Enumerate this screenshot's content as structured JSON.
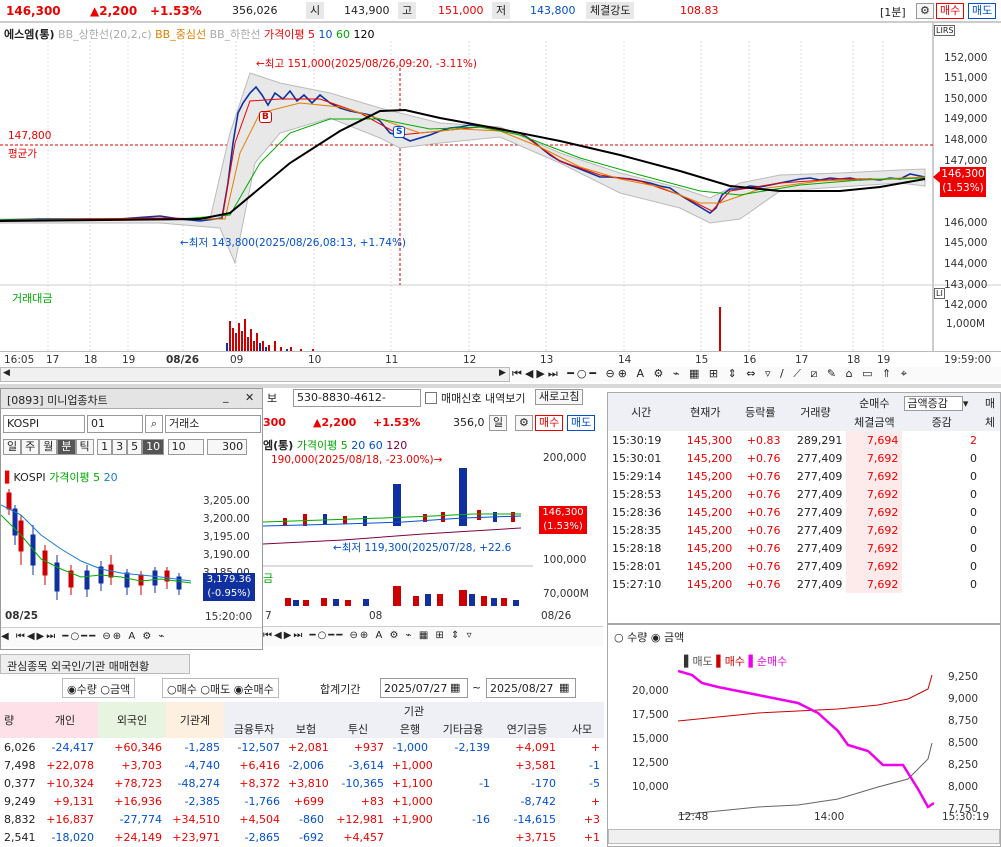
{
  "top": {
    "price": "146,300",
    "change": "▲2,200",
    "change_pct": "+1.53%",
    "volume": "356,026",
    "open_label": "시",
    "open": "143,900",
    "high_label": "고",
    "high": "151,000",
    "low_label": "저",
    "low": "143,800",
    "strength_label": "체결강도",
    "strength": "108.83",
    "interval": "[1분]",
    "buy": "매수",
    "sell": "매도"
  },
  "main": {
    "legend": {
      "name": "에스엠(통)",
      "bb_up": "BB_상한선(20,2,c)",
      "bb_mid": "BB_중심선",
      "bb_low": "BB_하한선",
      "ma": "가격이평 5",
      "ma10": "10",
      "ma60": "60",
      "ma120": "120"
    },
    "high_note": "←최고 151,000(2025/08/26,09:20, -3.11%)",
    "low_note": "←최저 143,800(2025/08/26,08:13, +1.74%)",
    "avg_value": "147,800",
    "avg_label": "평균가",
    "cur_price": "146,300",
    "cur_pct": "(1.53%)",
    "y_ticks": [
      "152,000",
      "151,000",
      "150,000",
      "149,000",
      "148,000",
      "147,000",
      "146,000",
      "145,000",
      "144,000",
      "143,000",
      "142,000"
    ],
    "vol_label": "거래대금",
    "vol_tick": "1,000M",
    "x_labels": [
      "16:05",
      "17",
      "18",
      "19",
      "08/26",
      "09",
      "10",
      "11",
      "12",
      "13",
      "14",
      "15",
      "16",
      "17",
      "18",
      "19",
      "19:59:00"
    ],
    "marker_b": "B",
    "marker_s": "S",
    "lrs": "LIRS",
    "li": "LI"
  },
  "mini": {
    "window_title": "[0893] 미니업종차트",
    "index": "KOSPI",
    "code": "01",
    "market": "거래소",
    "periods": [
      "일",
      "주",
      "월",
      "분",
      "틱",
      "1",
      "3",
      "5",
      "10"
    ],
    "period_val": "10",
    "count": "300",
    "legend": {
      "name": "KOSPI",
      "ma": "가격이평 5",
      "ma2": "20"
    },
    "y_ticks": [
      "3,205.00",
      "3,200.00",
      "3,195.00",
      "3,190.00",
      "3,185.00"
    ],
    "cur": "3,179.36",
    "cur_pct": "(-0.95%)",
    "x_left": "08/25",
    "x_right": "15:20:00"
  },
  "mid": {
    "tab": "보",
    "account": "530-8830-4612-",
    "signal": "매매신호 내역보기",
    "refresh": "새로고침",
    "price": "300",
    "change": "▲2,200",
    "pct": "+1.53%",
    "vol": "356,0",
    "period": "일",
    "legend": {
      "name": "엠(통)",
      "ma": "가격이평 5",
      "ma2": "20",
      "ma3": "60",
      "ma4": "120"
    },
    "high_note": "190,000(2025/08/18, -23.00%)→",
    "low_note": "←최저 119,300(2025/07/28, +22.6",
    "y_ticks": [
      "200,000",
      "100,000"
    ],
    "cur": "146,300",
    "cur_pct": "(1.53%)",
    "vol_label": "금",
    "vol_tick": "70,000M",
    "x_labels": [
      "7",
      "08",
      "08/26"
    ],
    "buy": "매수",
    "sell": "매도"
  },
  "ticks": {
    "headers": [
      "시간",
      "현재가",
      "등락률",
      "거래량",
      "순매수",
      "체결금액",
      "증감",
      "매"
    ],
    "net_select": "금액증감",
    "sub_last": "체",
    "rows": [
      [
        "15:30:19",
        "145,300",
        "+0.83",
        "289,291",
        "7,694",
        "2"
      ],
      [
        "15:30:01",
        "145,200",
        "+0.76",
        "277,409",
        "7,692",
        "0"
      ],
      [
        "15:29:14",
        "145,200",
        "+0.76",
        "277,409",
        "7,692",
        "0"
      ],
      [
        "15:28:53",
        "145,200",
        "+0.76",
        "277,409",
        "7,692",
        "0"
      ],
      [
        "15:28:36",
        "145,200",
        "+0.76",
        "277,409",
        "7,692",
        "0"
      ],
      [
        "15:28:35",
        "145,200",
        "+0.76",
        "277,409",
        "7,692",
        "0"
      ],
      [
        "15:28:18",
        "145,200",
        "+0.76",
        "277,409",
        "7,692",
        "0"
      ],
      [
        "15:28:01",
        "145,200",
        "+0.76",
        "277,409",
        "7,692",
        "0"
      ],
      [
        "15:27:10",
        "145,200",
        "+0.76",
        "277,409",
        "7,692",
        "0"
      ]
    ]
  },
  "flow": {
    "radio_qty": "수량",
    "radio_amt": "금액",
    "legend_sell": "매도",
    "legend_buy": "매수",
    "legend_net": "순매수",
    "y_left": [
      "20,000",
      "17,500",
      "15,000",
      "12,500",
      "10,000"
    ],
    "y_right": [
      "9,250",
      "9,000",
      "8,750",
      "8,500",
      "8,250",
      "8,000",
      "7,750"
    ],
    "x_labels": [
      "12:48",
      "14:00",
      "15:30:19"
    ]
  },
  "bottom": {
    "tab": "관심종목 외국인/기관 매매현황",
    "radios": [
      "수량",
      "금액",
      "매수",
      "매도",
      "순매수"
    ],
    "period_label": "합계기간",
    "from": "2025/07/27",
    "to": "2025/08/27",
    "group": "기관",
    "headers": [
      "량",
      "개인",
      "외국인",
      "기관계",
      "금융투자",
      "보험",
      "투신",
      "은행",
      "기타금융",
      "연기금등",
      "사모"
    ],
    "rows": [
      [
        "6,026",
        "-24,417",
        "+60,346",
        "-1,285",
        "-12,507",
        "+2,081",
        "+937",
        "-1,000",
        "-2,139",
        "+4,091",
        "+"
      ],
      [
        "7,498",
        "+22,078",
        "+3,703",
        "-4,740",
        "+6,416",
        "-2,006",
        "-3,614",
        "+1,000",
        "",
        "+3,581",
        "-1"
      ],
      [
        "0,377",
        "+10,324",
        "+78,723",
        "-48,274",
        "+8,372",
        "+3,810",
        "-10,365",
        "+1,100",
        "-1",
        "-170",
        "-5"
      ],
      [
        "9,249",
        "+9,131",
        "+16,936",
        "-2,385",
        "-1,766",
        "+699",
        "+83",
        "+1,000",
        "",
        "-8,742",
        "+"
      ],
      [
        "8,832",
        "+16,837",
        "-27,774",
        "+34,510",
        "+4,504",
        "-860",
        "+12,981",
        "+1,900",
        "-16",
        "-14,615",
        "+3"
      ],
      [
        "2,541",
        "-18,020",
        "+24,149",
        "+23,971",
        "-2,865",
        "-692",
        "+4,457",
        "",
        "",
        "+3,715",
        "+1"
      ]
    ]
  }
}
